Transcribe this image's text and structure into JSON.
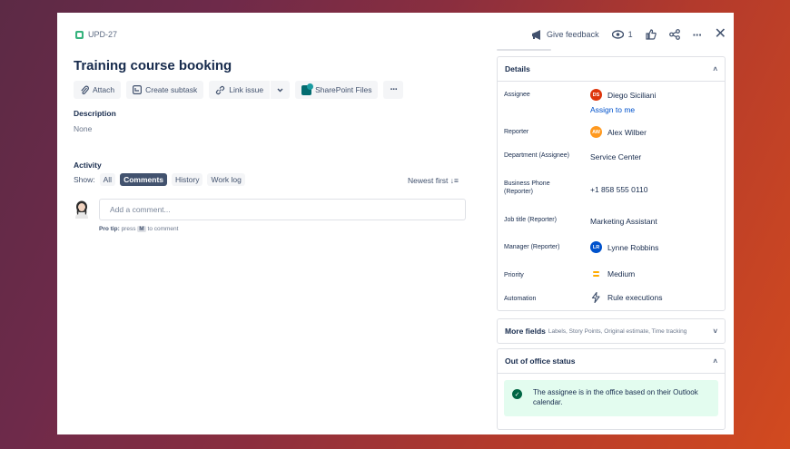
{
  "header": {
    "issue_key": "UPD-27",
    "feedback_label": "Give feedback",
    "watch_count": "1",
    "more_label": "···",
    "close_label": "✕"
  },
  "issue": {
    "title": "Training course booking",
    "toolbar": {
      "attach": "Attach",
      "create_subtask": "Create subtask",
      "link_issue": "Link issue",
      "dropdown_caret": "⌄",
      "sharepoint": "SharePoint Files",
      "more": "···"
    },
    "description_label": "Description",
    "description_value": "None"
  },
  "activity": {
    "label": "Activity",
    "show_label": "Show:",
    "filters": [
      "All",
      "Comments",
      "History",
      "Work log"
    ],
    "active_filter": "Comments",
    "sort_label": "Newest first ↓≡",
    "comment_placeholder": "Add a comment...",
    "protip_prefix": "Pro tip:",
    "protip_press": "press",
    "protip_key": "M",
    "protip_suffix": "to comment"
  },
  "details": {
    "heading": "Details",
    "caret": "˄",
    "fields": {
      "assignee": {
        "label": "Assignee",
        "value": "Diego Siciliani",
        "initials": "DS",
        "color": "#de350b"
      },
      "assign_to_me": "Assign to me",
      "reporter": {
        "label": "Reporter",
        "value": "Alex Wilber",
        "initials": "AW",
        "color": "#ff991f"
      },
      "department": {
        "label": "Department (Assignee)",
        "value": "Service Center"
      },
      "phone": {
        "label": "Business Phone (Reporter)",
        "value": "+1 858 555 0110"
      },
      "job_title": {
        "label": "Job title (Reporter)",
        "value": "Marketing Assistant"
      },
      "manager": {
        "label": "Manager (Reporter)",
        "value": "Lynne Robbins",
        "initials": "LR",
        "color": "#0052cc"
      },
      "priority": {
        "label": "Priority",
        "value": "Medium",
        "color": "#ffab00"
      },
      "automation": {
        "label": "Automation",
        "value": "Rule executions"
      }
    }
  },
  "more_fields": {
    "heading": "More fields",
    "subtitle": "Labels, Story Points, Original estimate, Time tracking",
    "caret": "˅"
  },
  "out_of_office": {
    "heading": "Out of office status",
    "caret": "˄",
    "message": "The assignee is in the office based on their Outlook calendar.",
    "check": "✓"
  }
}
